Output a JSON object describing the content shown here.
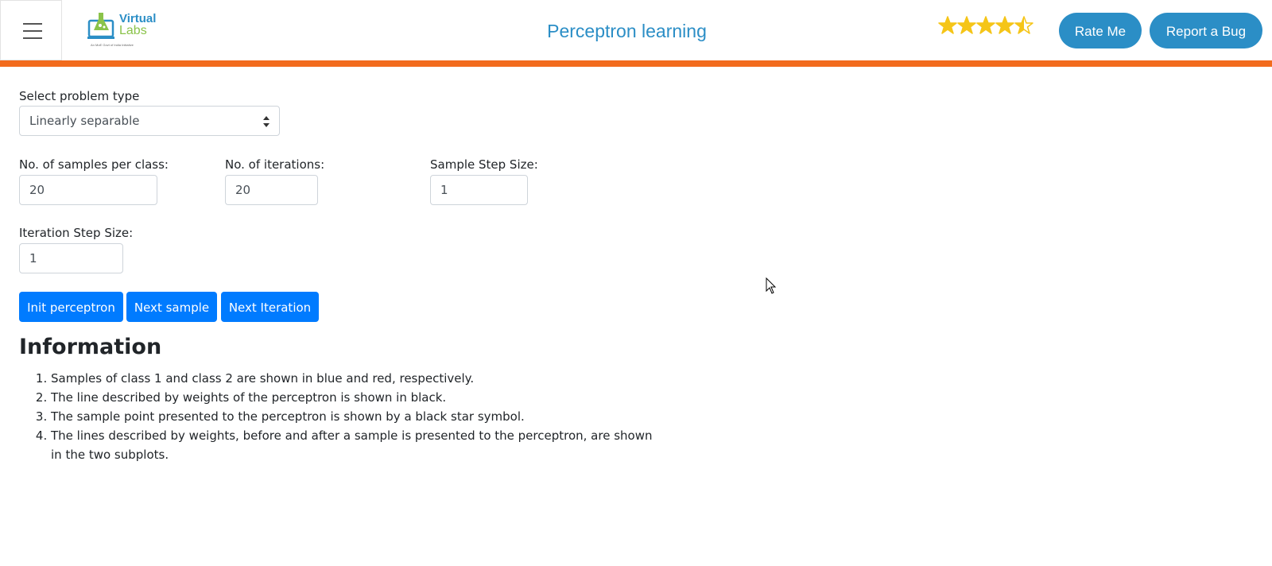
{
  "header": {
    "menu_icon": "hamburger-menu-icon",
    "logo": {
      "word1": "Virtual",
      "word2": "Labs",
      "tagline": "An MoE Govt of India Initiative"
    },
    "title": "Perceptron learning",
    "rating": 4.5,
    "rating_max": 5,
    "rate_button": "Rate Me",
    "bug_button": "Report a Bug",
    "accent_color": "#2b8ec6",
    "bar_color": "#f26b1d"
  },
  "form": {
    "problem_type_label": "Select problem type",
    "problem_type_value": "Linearly separable",
    "samples_label": "No. of samples per class:",
    "samples_value": "20",
    "iterations_label": "No. of iterations:",
    "iterations_value": "20",
    "sample_step_label": "Sample Step Size:",
    "sample_step_value": "1",
    "iteration_step_label": "Iteration Step Size:",
    "iteration_step_value": "1"
  },
  "buttons": {
    "init": "Init perceptron",
    "next_sample": "Next sample",
    "next_iteration": "Next Iteration",
    "color": "#007bff"
  },
  "info": {
    "title": "Information",
    "items": [
      "Samples of class 1 and class 2 are shown in blue and red, respectively.",
      "The line described by weights of the perceptron is shown in black.",
      "The sample point presented to the perceptron is shown by a black star symbol.",
      "The lines described by weights, before and after a sample is presented to the perceptron, are shown in the two subplots."
    ]
  }
}
